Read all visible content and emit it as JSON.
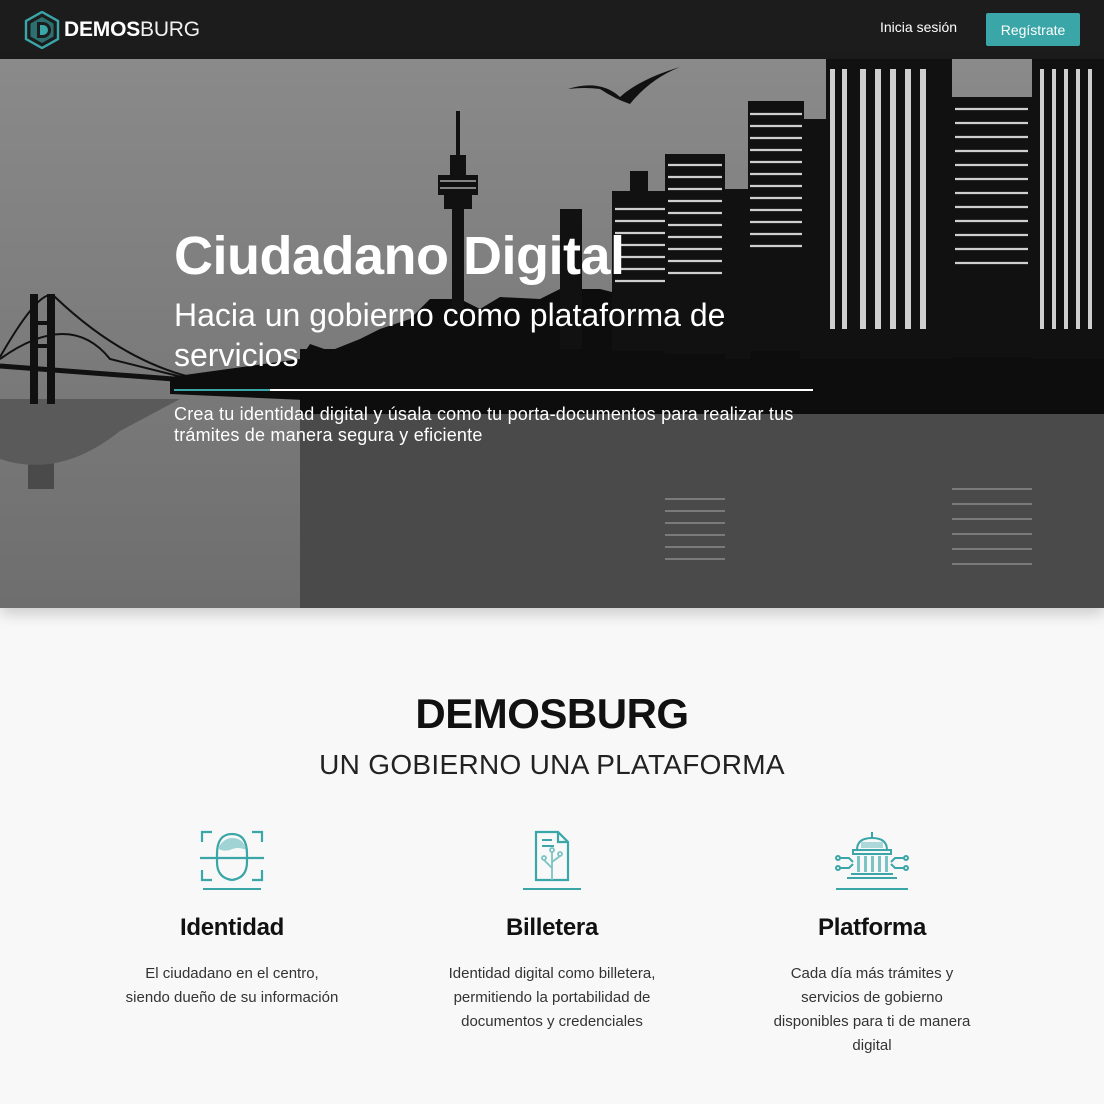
{
  "nav": {
    "logo_bold": "DEMOS",
    "logo_light": "BURG",
    "login_label": "Inicia sesión",
    "register_label": "Regístrate"
  },
  "hero": {
    "title": "Ciudadano Digital",
    "subtitle": "Hacia un gobierno como plataforma de servicios",
    "description": "Crea tu identidad digital y úsala como tu porta-documentos para realizar tus trámites de manera segura y eficiente"
  },
  "section": {
    "title": "DEMOSBURG",
    "subtitle": "UN GOBIERNO UNA PLATAFORMA"
  },
  "features": [
    {
      "icon": "face-scan-icon",
      "title": "Identidad",
      "text": "El ciudadano en el centro, siendo dueño de su información"
    },
    {
      "icon": "document-wallet-icon",
      "title": "Billetera",
      "text": "Identidad digital como billetera, permitiendo la portabilidad de documentos y credenciales"
    },
    {
      "icon": "government-building-icon",
      "title": "Platforma",
      "text": "Cada día más trámites y servicios de gobierno disponibles para ti de manera digital"
    }
  ],
  "colors": {
    "accent": "#3aa6a8",
    "nav_bg": "#1c1c1c",
    "hero_bg": "#7a7a7a"
  }
}
